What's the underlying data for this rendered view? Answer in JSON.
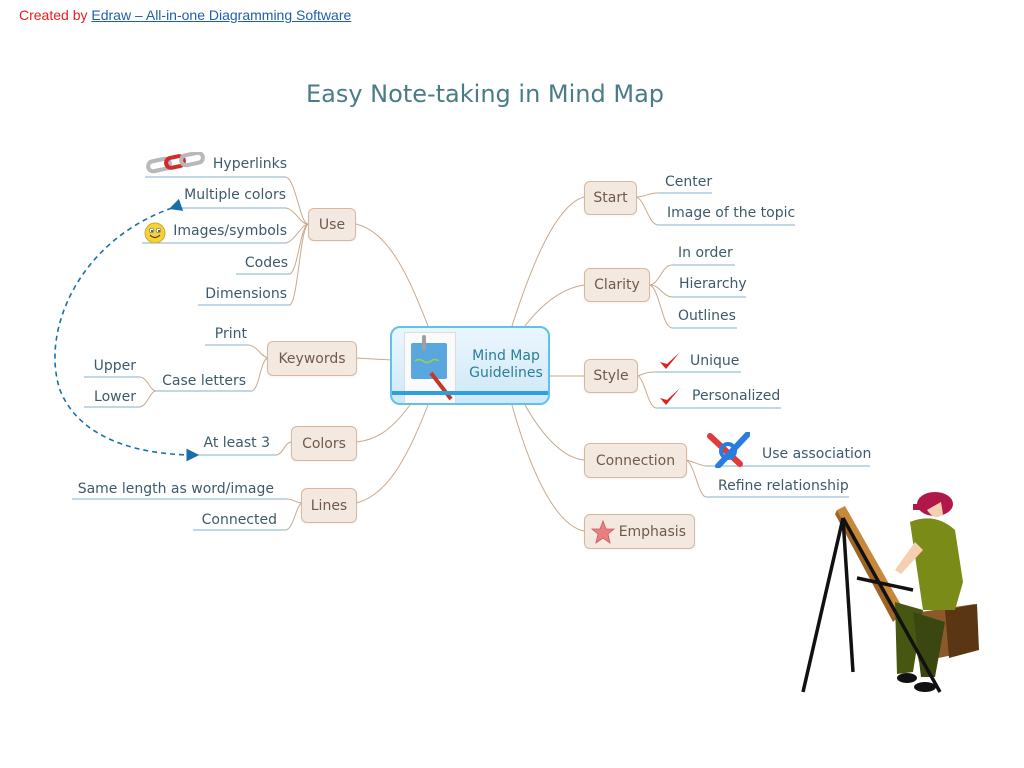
{
  "credit": {
    "prefix": "Created by",
    "link_text": "Edraw – All-in-one Diagramming Software"
  },
  "title": "Easy Note-taking in Mind Map",
  "central_topic": {
    "line1": "Mind Map",
    "line2": "Guidelines",
    "icon": "notepad-pencil-icon"
  },
  "colors": {
    "topic_fill": "#f3e9e0",
    "topic_border": "#d9b79c",
    "branch_line": "#c9a98e",
    "leaf_underline": "#7fb1cc",
    "arrow": "#1a6fa8",
    "central_border": "#5ec3ea",
    "title": "#4a7c88"
  },
  "left_branches": {
    "use": {
      "label": "Use",
      "children": [
        "Hyperlinks",
        "Multiple colors",
        "Images/symbols",
        "Codes",
        "Dimensions"
      ],
      "icons": [
        "chain-link-icon",
        "",
        "smiley-icon",
        "",
        ""
      ]
    },
    "keywords": {
      "label": "Keywords",
      "children": [
        "Print",
        "Case letters"
      ],
      "case_letters_children": [
        "Upper",
        "Lower"
      ]
    },
    "colors": {
      "label": "Colors",
      "children": [
        "At least 3"
      ]
    },
    "lines": {
      "label": "Lines",
      "children": [
        "Same length as word/image",
        "Connected"
      ]
    }
  },
  "right_branches": {
    "start": {
      "label": "Start",
      "children": [
        "Center",
        "Image of the topic"
      ]
    },
    "clarity": {
      "label": "Clarity",
      "children": [
        "In order",
        "Hierarchy",
        "Outlines"
      ]
    },
    "style": {
      "label": "Style",
      "children": [
        "Unique",
        "Personalized"
      ],
      "icons": [
        "checkmark-icon",
        "checkmark-icon"
      ]
    },
    "connection": {
      "label": "Connection",
      "children": [
        "Use association",
        "Refine relationship"
      ],
      "icons": [
        "knot-icon",
        ""
      ]
    },
    "emphasis": {
      "label": "Emphasis",
      "icon": "star-icon"
    }
  },
  "illustration": "painter-at-easel"
}
